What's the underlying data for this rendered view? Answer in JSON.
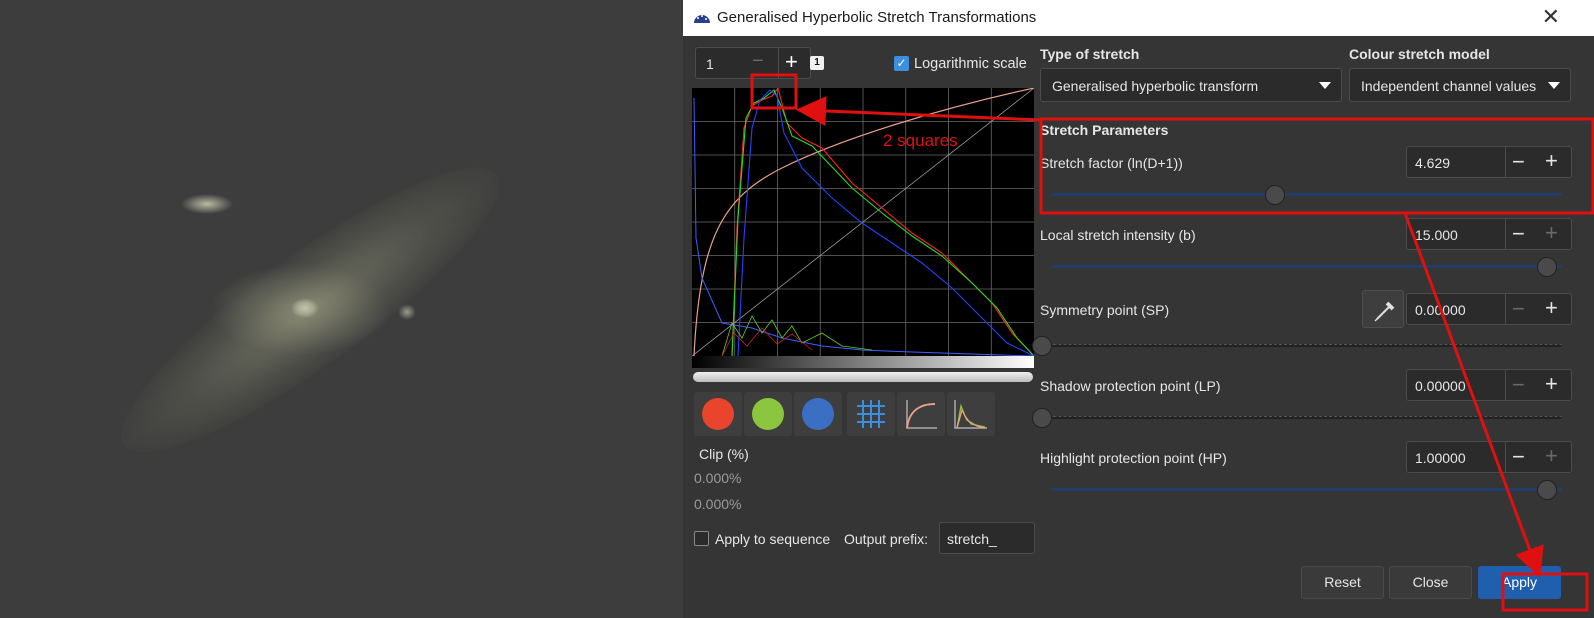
{
  "window": {
    "title": "Generalised Hyperbolic Stretch Transformations"
  },
  "histogram": {
    "zoom_value": "1",
    "zoom_reset_label": "1",
    "log_scale_label": "Logarithmic scale",
    "log_scale_checked": true,
    "annotation": "2 squares"
  },
  "channels": [
    {
      "name": "red",
      "color": "#e8452c"
    },
    {
      "name": "green",
      "color": "#8cc63f"
    },
    {
      "name": "blue",
      "color": "#3b6fc4"
    }
  ],
  "clip": {
    "label": "Clip (%)",
    "low": "0.000%",
    "high": "0.000%"
  },
  "sequence": {
    "apply_label": "Apply to sequence",
    "prefix_label": "Output prefix:",
    "prefix_value": "stretch_"
  },
  "stretch_type": {
    "title": "Type of stretch",
    "value": "Generalised hyperbolic transform"
  },
  "colour_model": {
    "title": "Colour stretch model",
    "value": "Independent channel values"
  },
  "params": {
    "title": "Stretch Parameters",
    "items": [
      {
        "label": "Stretch factor (ln(D+1))",
        "value": "4.629",
        "fraction": 0.46
      },
      {
        "label": "Local stretch intensity (b)",
        "value": "15.000",
        "fraction": 1.0
      },
      {
        "label": "Symmetry point (SP)",
        "value": "0.00000",
        "fraction": 0.0
      },
      {
        "label": "Shadow protection point (LP)",
        "value": "0.00000",
        "fraction": 0.0
      },
      {
        "label": "Highlight protection point (HP)",
        "value": "1.00000",
        "fraction": 1.0
      }
    ]
  },
  "buttons": {
    "reset": "Reset",
    "close": "Close",
    "apply": "Apply"
  },
  "colors": {
    "accent": "#1f5fae",
    "annotation": "#e01010"
  }
}
